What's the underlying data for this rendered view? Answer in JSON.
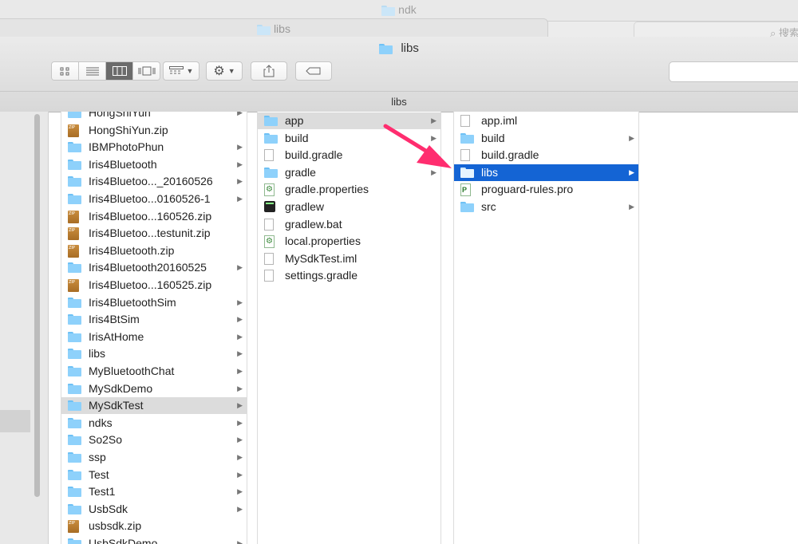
{
  "background_windows": [
    {
      "title": "ndk"
    },
    {
      "title": "libs"
    }
  ],
  "background_search": {
    "placeholder": "搜索"
  },
  "window": {
    "title": "libs",
    "path_title": "libs"
  },
  "toolbar": {
    "view_modes": [
      "icon-view",
      "list-view",
      "column-view",
      "cover-flow-view"
    ],
    "active_view": "column-view"
  },
  "columns": [
    {
      "items": [
        {
          "name": "HongShiYun",
          "type": "folder",
          "arrow": true
        },
        {
          "name": "HongShiYun.zip",
          "type": "zip",
          "arrow": false
        },
        {
          "name": "IBMPhotoPhun",
          "type": "folder",
          "arrow": true
        },
        {
          "name": "Iris4Bluetooth",
          "type": "folder",
          "arrow": true
        },
        {
          "name": "Iris4Bluetoo..._20160526",
          "type": "folder",
          "arrow": true
        },
        {
          "name": "Iris4Bluetoo...0160526-1",
          "type": "folder",
          "arrow": true
        },
        {
          "name": "Iris4Bluetoo...160526.zip",
          "type": "zip",
          "arrow": false
        },
        {
          "name": "Iris4Bluetoo...testunit.zip",
          "type": "zip",
          "arrow": false
        },
        {
          "name": "Iris4Bluetooth.zip",
          "type": "zip",
          "arrow": false
        },
        {
          "name": "Iris4Bluetooth20160525",
          "type": "folder",
          "arrow": true
        },
        {
          "name": "Iris4Bluetoo...160525.zip",
          "type": "zip",
          "arrow": false
        },
        {
          "name": "Iris4BluetoothSim",
          "type": "folder",
          "arrow": true
        },
        {
          "name": "Iris4BtSim",
          "type": "folder",
          "arrow": true
        },
        {
          "name": "IrisAtHome",
          "type": "folder",
          "arrow": true
        },
        {
          "name": "libs",
          "type": "folder",
          "arrow": true
        },
        {
          "name": "MyBluetoothChat",
          "type": "folder",
          "arrow": true
        },
        {
          "name": "MySdkDemo",
          "type": "folder",
          "arrow": true
        },
        {
          "name": "MySdkTest",
          "type": "folder",
          "arrow": true,
          "state": "grey"
        },
        {
          "name": "ndks",
          "type": "folder",
          "arrow": true
        },
        {
          "name": "So2So",
          "type": "folder",
          "arrow": true
        },
        {
          "name": "ssp",
          "type": "folder",
          "arrow": true
        },
        {
          "name": "Test",
          "type": "folder",
          "arrow": true
        },
        {
          "name": "Test1",
          "type": "folder",
          "arrow": true
        },
        {
          "name": "UsbSdk",
          "type": "folder",
          "arrow": true
        },
        {
          "name": "usbsdk.zip",
          "type": "zip",
          "arrow": false
        },
        {
          "name": "UsbSdkDemo",
          "type": "folder",
          "arrow": true
        }
      ]
    },
    {
      "items": [
        {
          "name": "app",
          "type": "folder",
          "arrow": true,
          "state": "grey"
        },
        {
          "name": "build",
          "type": "folder",
          "arrow": true
        },
        {
          "name": "build.gradle",
          "type": "doc",
          "arrow": false
        },
        {
          "name": "gradle",
          "type": "folder",
          "arrow": true
        },
        {
          "name": "gradle.properties",
          "type": "gear-doc",
          "arrow": false
        },
        {
          "name": "gradlew",
          "type": "terminal",
          "arrow": false
        },
        {
          "name": "gradlew.bat",
          "type": "doc",
          "arrow": false
        },
        {
          "name": "local.properties",
          "type": "gear-doc",
          "arrow": false
        },
        {
          "name": "MySdkTest.iml",
          "type": "doc",
          "arrow": false
        },
        {
          "name": "settings.gradle",
          "type": "doc",
          "arrow": false
        }
      ]
    },
    {
      "items": [
        {
          "name": "app.iml",
          "type": "doc",
          "arrow": false
        },
        {
          "name": "build",
          "type": "folder",
          "arrow": true
        },
        {
          "name": "build.gradle",
          "type": "doc",
          "arrow": false
        },
        {
          "name": "libs",
          "type": "folder",
          "arrow": true,
          "state": "blue"
        },
        {
          "name": "proguard-rules.pro",
          "type": "pro",
          "arrow": false
        },
        {
          "name": "src",
          "type": "folder",
          "arrow": true
        }
      ]
    }
  ],
  "annotation": {
    "color": "#ff2d6f"
  }
}
